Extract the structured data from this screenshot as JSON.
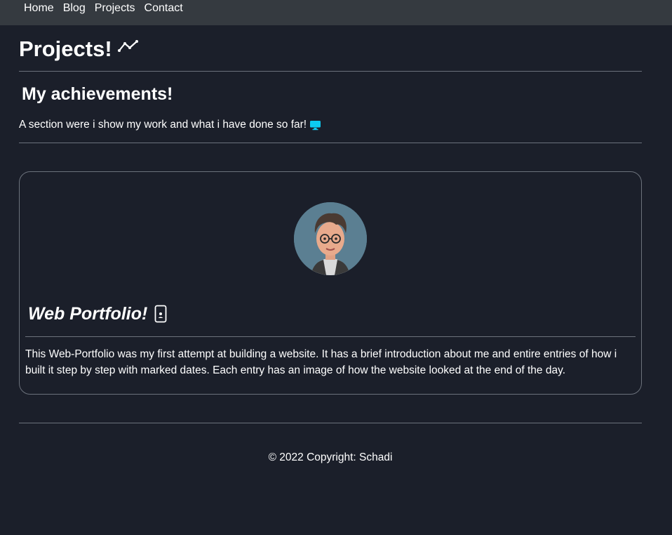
{
  "nav": {
    "items": [
      {
        "label": "Home"
      },
      {
        "label": "Blog"
      },
      {
        "label": "Projects"
      },
      {
        "label": "Contact"
      }
    ]
  },
  "header": {
    "title": "Projects!",
    "title_icon": "chart-line-icon"
  },
  "section": {
    "title": "My achievements!",
    "text": "A section were i show my work and what i have done so far!",
    "text_icon": "display-icon"
  },
  "card": {
    "image": "avatar-image",
    "title": "Web Portfolio!",
    "title_icon": "phone-icon",
    "text": "This Web-Portfolio was my first attempt at building a website. It has a brief introduction about me and entire entries of how i built it step by step with marked dates. Each entry has an image of how the website looked at the end of the day."
  },
  "footer": {
    "text": "© 2022 Copyright: Schadi"
  },
  "colors": {
    "background": "#1b1f2a",
    "navbar": "#353a40",
    "divider": "#6c727c",
    "accent_icon": "#0dcaf0"
  }
}
